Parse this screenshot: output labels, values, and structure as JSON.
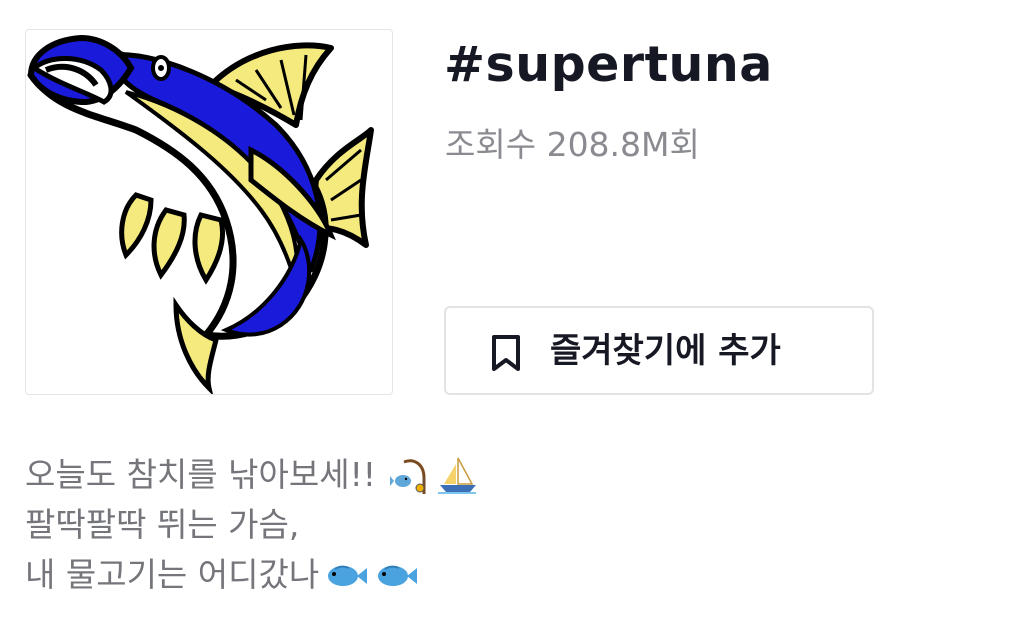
{
  "hashtag": {
    "title": "#supertuna",
    "views": "조회수 208.8M회"
  },
  "cover": {
    "icon": "tuna-fish-illustration",
    "colors": {
      "body_blue": "#1a1adb",
      "fin_yellow": "#f4ea7e",
      "outline": "#000000"
    }
  },
  "favorite_button": {
    "label": "즐겨찾기에 추가",
    "icon": "bookmark-icon"
  },
  "description": {
    "lines": [
      "오늘도 참치를 낚아보세!!",
      "팔딱팔딱 뛰는 가슴,",
      "내 물고기는 어디갔나"
    ],
    "emojis": [
      "fishing-pole-emoji",
      "sailboat-emoji",
      "fish-emoji",
      "fish-emoji"
    ]
  },
  "colors": {
    "title_text": "#161823",
    "secondary_text": "#8a8b91",
    "border": "#e3e3e4"
  }
}
